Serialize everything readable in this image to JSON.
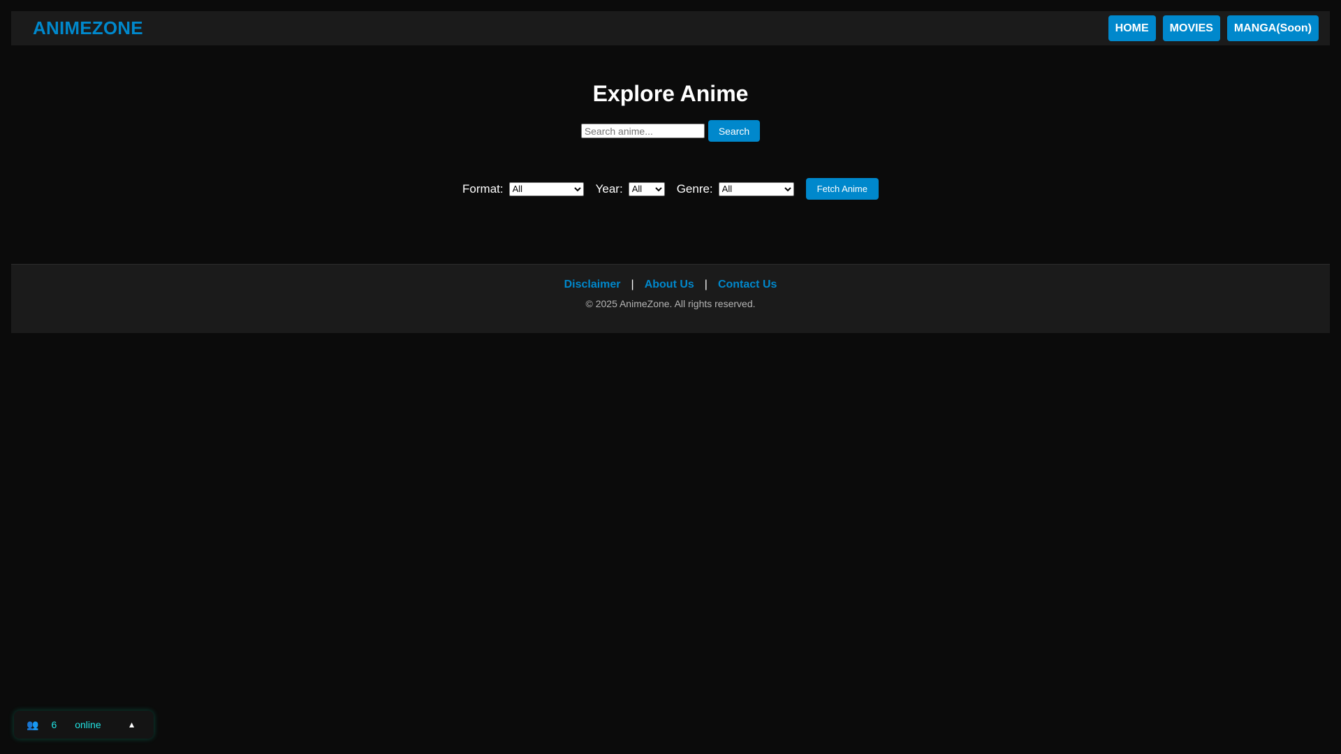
{
  "header": {
    "logo": "ANIMEZONE",
    "nav": [
      {
        "label": "HOME"
      },
      {
        "label": "MOVIES"
      },
      {
        "label": "MANGA(Soon)"
      }
    ]
  },
  "main": {
    "title": "Explore Anime",
    "search": {
      "placeholder": "Search anime...",
      "value": "",
      "button_label": "Search"
    },
    "filters": {
      "format_label": "Format:",
      "format_value": "All",
      "year_label": "Year:",
      "year_value": "All",
      "genre_label": "Genre:",
      "genre_value": "All",
      "fetch_label": "Fetch Anime"
    }
  },
  "footer": {
    "links": [
      {
        "label": "Disclaimer"
      },
      {
        "label": "About Us"
      },
      {
        "label": "Contact Us"
      }
    ],
    "separator": "|",
    "copyright": "© 2025 AnimeZone. All rights reserved."
  },
  "online_widget": {
    "icon": "users-icon",
    "icon_glyph": "👥",
    "count": "6",
    "label": "online",
    "toggle_glyph": "▲"
  },
  "colors": {
    "accent": "#0088cc",
    "background": "#0b0b0b",
    "panel": "#1b1b1b",
    "online_text": "#22e3e3"
  }
}
